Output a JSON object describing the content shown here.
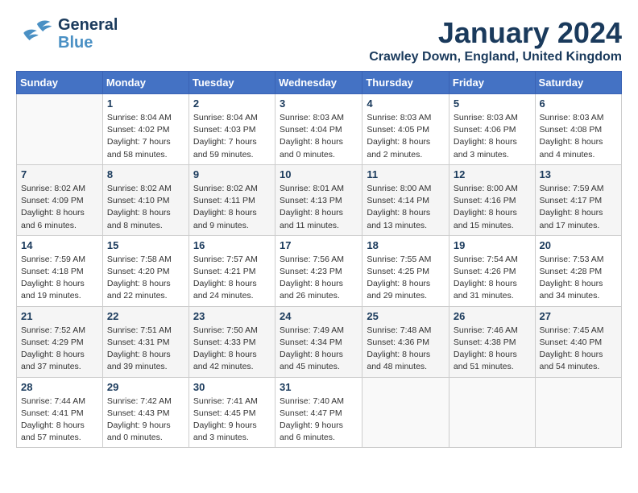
{
  "header": {
    "logo_line1": "General",
    "logo_line2": "Blue",
    "month": "January 2024",
    "location": "Crawley Down, England, United Kingdom"
  },
  "weekdays": [
    "Sunday",
    "Monday",
    "Tuesday",
    "Wednesday",
    "Thursday",
    "Friday",
    "Saturday"
  ],
  "weeks": [
    [
      {
        "day": "",
        "sunrise": "",
        "sunset": "",
        "daylight": ""
      },
      {
        "day": "1",
        "sunrise": "Sunrise: 8:04 AM",
        "sunset": "Sunset: 4:02 PM",
        "daylight": "Daylight: 7 hours and 58 minutes."
      },
      {
        "day": "2",
        "sunrise": "Sunrise: 8:04 AM",
        "sunset": "Sunset: 4:03 PM",
        "daylight": "Daylight: 7 hours and 59 minutes."
      },
      {
        "day": "3",
        "sunrise": "Sunrise: 8:03 AM",
        "sunset": "Sunset: 4:04 PM",
        "daylight": "Daylight: 8 hours and 0 minutes."
      },
      {
        "day": "4",
        "sunrise": "Sunrise: 8:03 AM",
        "sunset": "Sunset: 4:05 PM",
        "daylight": "Daylight: 8 hours and 2 minutes."
      },
      {
        "day": "5",
        "sunrise": "Sunrise: 8:03 AM",
        "sunset": "Sunset: 4:06 PM",
        "daylight": "Daylight: 8 hours and 3 minutes."
      },
      {
        "day": "6",
        "sunrise": "Sunrise: 8:03 AM",
        "sunset": "Sunset: 4:08 PM",
        "daylight": "Daylight: 8 hours and 4 minutes."
      }
    ],
    [
      {
        "day": "7",
        "sunrise": "Sunrise: 8:02 AM",
        "sunset": "Sunset: 4:09 PM",
        "daylight": "Daylight: 8 hours and 6 minutes."
      },
      {
        "day": "8",
        "sunrise": "Sunrise: 8:02 AM",
        "sunset": "Sunset: 4:10 PM",
        "daylight": "Daylight: 8 hours and 8 minutes."
      },
      {
        "day": "9",
        "sunrise": "Sunrise: 8:02 AM",
        "sunset": "Sunset: 4:11 PM",
        "daylight": "Daylight: 8 hours and 9 minutes."
      },
      {
        "day": "10",
        "sunrise": "Sunrise: 8:01 AM",
        "sunset": "Sunset: 4:13 PM",
        "daylight": "Daylight: 8 hours and 11 minutes."
      },
      {
        "day": "11",
        "sunrise": "Sunrise: 8:00 AM",
        "sunset": "Sunset: 4:14 PM",
        "daylight": "Daylight: 8 hours and 13 minutes."
      },
      {
        "day": "12",
        "sunrise": "Sunrise: 8:00 AM",
        "sunset": "Sunset: 4:16 PM",
        "daylight": "Daylight: 8 hours and 15 minutes."
      },
      {
        "day": "13",
        "sunrise": "Sunrise: 7:59 AM",
        "sunset": "Sunset: 4:17 PM",
        "daylight": "Daylight: 8 hours and 17 minutes."
      }
    ],
    [
      {
        "day": "14",
        "sunrise": "Sunrise: 7:59 AM",
        "sunset": "Sunset: 4:18 PM",
        "daylight": "Daylight: 8 hours and 19 minutes."
      },
      {
        "day": "15",
        "sunrise": "Sunrise: 7:58 AM",
        "sunset": "Sunset: 4:20 PM",
        "daylight": "Daylight: 8 hours and 22 minutes."
      },
      {
        "day": "16",
        "sunrise": "Sunrise: 7:57 AM",
        "sunset": "Sunset: 4:21 PM",
        "daylight": "Daylight: 8 hours and 24 minutes."
      },
      {
        "day": "17",
        "sunrise": "Sunrise: 7:56 AM",
        "sunset": "Sunset: 4:23 PM",
        "daylight": "Daylight: 8 hours and 26 minutes."
      },
      {
        "day": "18",
        "sunrise": "Sunrise: 7:55 AM",
        "sunset": "Sunset: 4:25 PM",
        "daylight": "Daylight: 8 hours and 29 minutes."
      },
      {
        "day": "19",
        "sunrise": "Sunrise: 7:54 AM",
        "sunset": "Sunset: 4:26 PM",
        "daylight": "Daylight: 8 hours and 31 minutes."
      },
      {
        "day": "20",
        "sunrise": "Sunrise: 7:53 AM",
        "sunset": "Sunset: 4:28 PM",
        "daylight": "Daylight: 8 hours and 34 minutes."
      }
    ],
    [
      {
        "day": "21",
        "sunrise": "Sunrise: 7:52 AM",
        "sunset": "Sunset: 4:29 PM",
        "daylight": "Daylight: 8 hours and 37 minutes."
      },
      {
        "day": "22",
        "sunrise": "Sunrise: 7:51 AM",
        "sunset": "Sunset: 4:31 PM",
        "daylight": "Daylight: 8 hours and 39 minutes."
      },
      {
        "day": "23",
        "sunrise": "Sunrise: 7:50 AM",
        "sunset": "Sunset: 4:33 PM",
        "daylight": "Daylight: 8 hours and 42 minutes."
      },
      {
        "day": "24",
        "sunrise": "Sunrise: 7:49 AM",
        "sunset": "Sunset: 4:34 PM",
        "daylight": "Daylight: 8 hours and 45 minutes."
      },
      {
        "day": "25",
        "sunrise": "Sunrise: 7:48 AM",
        "sunset": "Sunset: 4:36 PM",
        "daylight": "Daylight: 8 hours and 48 minutes."
      },
      {
        "day": "26",
        "sunrise": "Sunrise: 7:46 AM",
        "sunset": "Sunset: 4:38 PM",
        "daylight": "Daylight: 8 hours and 51 minutes."
      },
      {
        "day": "27",
        "sunrise": "Sunrise: 7:45 AM",
        "sunset": "Sunset: 4:40 PM",
        "daylight": "Daylight: 8 hours and 54 minutes."
      }
    ],
    [
      {
        "day": "28",
        "sunrise": "Sunrise: 7:44 AM",
        "sunset": "Sunset: 4:41 PM",
        "daylight": "Daylight: 8 hours and 57 minutes."
      },
      {
        "day": "29",
        "sunrise": "Sunrise: 7:42 AM",
        "sunset": "Sunset: 4:43 PM",
        "daylight": "Daylight: 9 hours and 0 minutes."
      },
      {
        "day": "30",
        "sunrise": "Sunrise: 7:41 AM",
        "sunset": "Sunset: 4:45 PM",
        "daylight": "Daylight: 9 hours and 3 minutes."
      },
      {
        "day": "31",
        "sunrise": "Sunrise: 7:40 AM",
        "sunset": "Sunset: 4:47 PM",
        "daylight": "Daylight: 9 hours and 6 minutes."
      },
      {
        "day": "",
        "sunrise": "",
        "sunset": "",
        "daylight": ""
      },
      {
        "day": "",
        "sunrise": "",
        "sunset": "",
        "daylight": ""
      },
      {
        "day": "",
        "sunrise": "",
        "sunset": "",
        "daylight": ""
      }
    ]
  ]
}
